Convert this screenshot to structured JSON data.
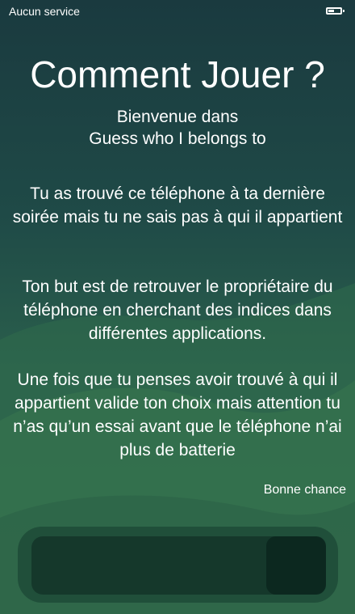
{
  "status_bar": {
    "carrier": "Aucun service",
    "battery_level": 0.6
  },
  "title": "Comment Jouer ?",
  "welcome": {
    "line1": "Bienvenue dans",
    "line2": "Guess who I belongs to"
  },
  "paragraphs": [
    "Tu as trouvé ce téléphone à ta dernière soirée mais tu ne sais pas à qui il appartient",
    "Ton but est de retrouver le propriétaire du téléphone en cherchant des indices dans différentes applications.",
    "Une fois que tu penses avoir trouvé à qui il appartient valide ton choix mais attention tu n’as qu’un essai avant que le téléphone n’ai plus de batterie"
  ],
  "signoff": "Bonne chance",
  "colors": {
    "background_top": "#1a3a3f",
    "background_bottom": "#2e6a4d",
    "text": "#ffffff"
  }
}
